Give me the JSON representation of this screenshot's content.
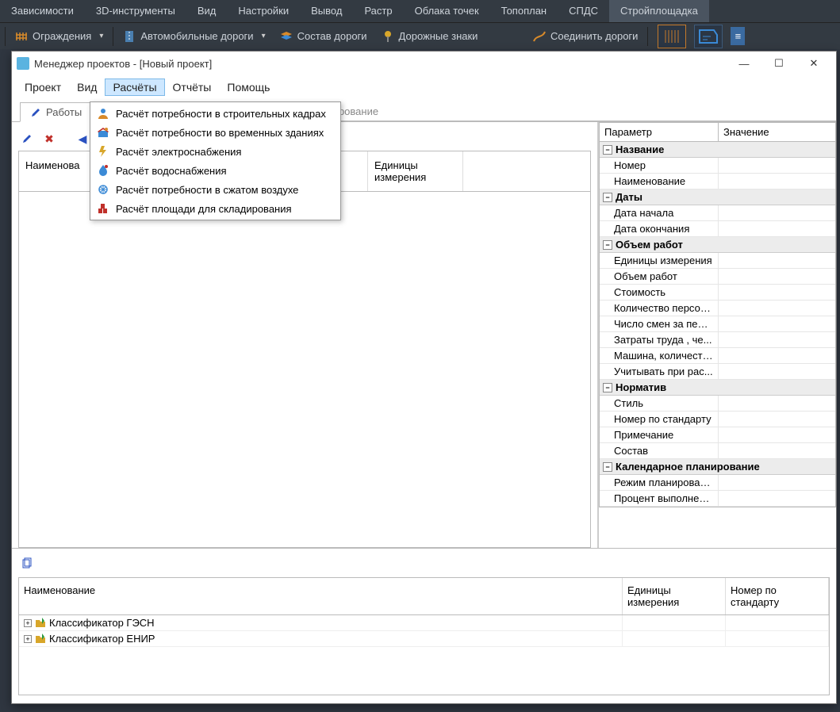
{
  "main_menu": [
    "Зависимости",
    "3D-инструменты",
    "Вид",
    "Настройки",
    "Вывод",
    "Растр",
    "Облака точек",
    "Топоплан",
    "СПДС",
    "Стройплощадка"
  ],
  "main_menu_active": 9,
  "ribbon": {
    "fences": "Ограждения",
    "roads": "Автомобильные дороги",
    "road_comp": "Состав дороги",
    "signs": "Дорожные знаки",
    "connect": "Соединить дороги"
  },
  "window": {
    "title": "Менеджер проектов - [Новый проект]",
    "menu": [
      "Проект",
      "Вид",
      "Расчёты",
      "Отчёты",
      "Помощь"
    ],
    "menu_open": 2
  },
  "dropdown_items": [
    "Расчёт потребности в строительных кадрах",
    "Расчёт потребности во временных зданиях",
    "Расчёт электроснабжения",
    "Расчёт водоснабжения",
    "Расчёт потребности в сжатом воздухе",
    "Расчёт площади для складирования"
  ],
  "tabs": {
    "works": "Работы",
    "planning_tail": "рное планирование"
  },
  "work_table": {
    "col_name": "Наименова",
    "col_units": "Единицы измерения"
  },
  "prop": {
    "hdr_param": "Параметр",
    "hdr_value": "Значение",
    "groups": [
      {
        "title": "Название",
        "rows": [
          "Номер",
          "Наименование"
        ]
      },
      {
        "title": "Даты",
        "rows": [
          "Дата начала",
          "Дата окончания"
        ]
      },
      {
        "title": "Объем работ",
        "rows": [
          "Единицы измерения",
          "Объем работ",
          "Стоимость",
          "Количество персон...",
          "Число смен за пери...",
          "Затраты труда , че...",
          "Машина, количеств...",
          "Учитывать при рас..."
        ]
      },
      {
        "title": "Норматив",
        "rows": [
          "Стиль",
          "Номер по стандарту",
          "Примечание",
          "Состав"
        ]
      },
      {
        "title": "Календарное планирование",
        "rows": [
          "Режим планирования",
          "Процент выполнения"
        ]
      }
    ]
  },
  "bottom": {
    "col_name": "Наименование",
    "col_units": "Единицы измерения",
    "col_std": "Номер по стандарту",
    "rows": [
      "Классификатор ГЭСН",
      "Классификатор ЕНИР"
    ]
  }
}
